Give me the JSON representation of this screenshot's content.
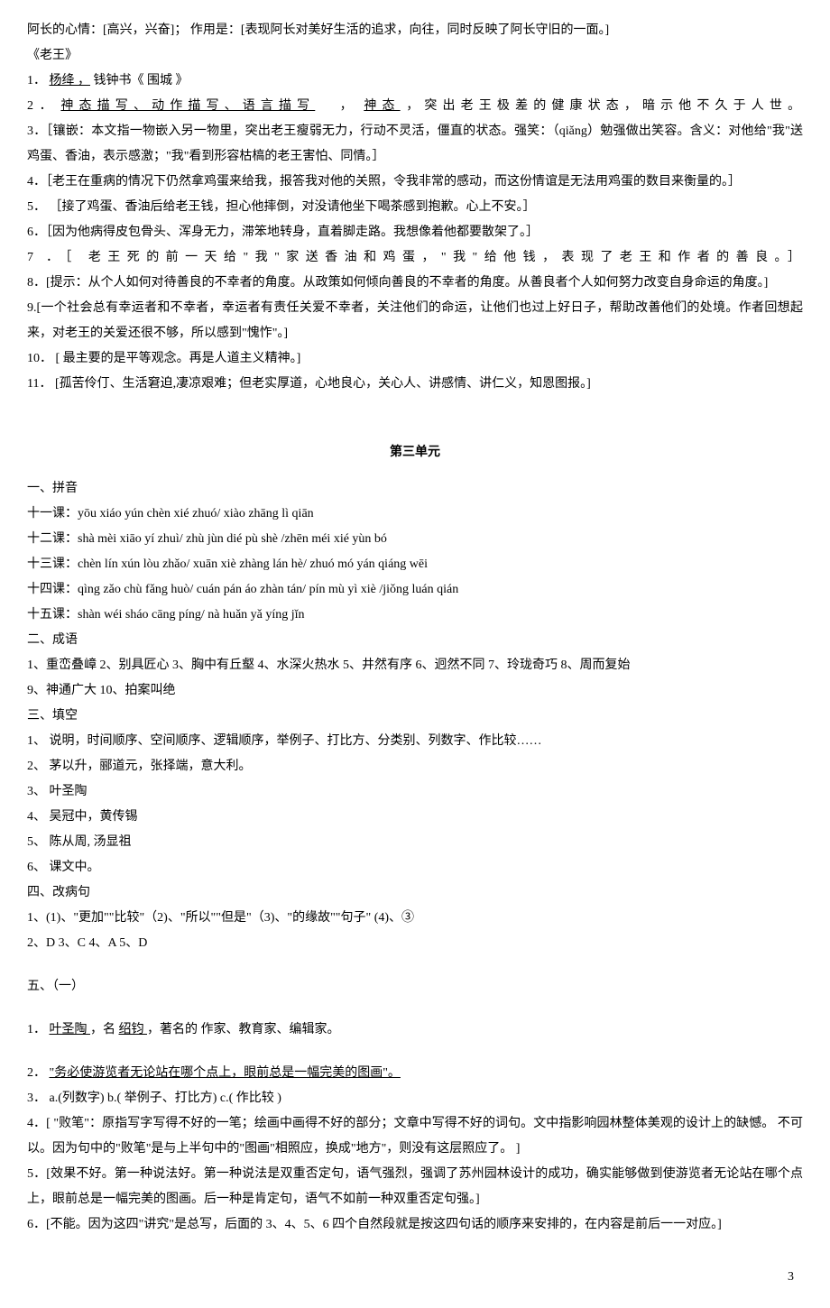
{
  "top": {
    "l1": "阿长的心情：[高兴，兴奋]；   作用是：[表现阿长对美好生活的追求，向往，同时反映了阿长守旧的一面。]",
    "l2": "《老王》",
    "l3_a": "1．",
    "l3_b": "杨绛 ，",
    "l3_c": "钱钟书《 围城 》",
    "l4_a": "2  ． ",
    "l4_b": "神态描写、动作描写、语言描写",
    "l4_c": "，",
    "l4_d": "神态",
    "l4_e": "，突出老王极差的健康状态，暗示他不久于人世。",
    "l5": "3．［镶嵌：本文指一物嵌入另一物里，突出老王瘦弱无力，行动不灵活，僵直的状态。强笑：（qiǎng）勉强做出笑容。含义：对他给\"我\"送鸡蛋、香油，表示感激；\"我\"看到形容枯槁的老王害怕、同情。］",
    "l6": "4．［老王在重病的情况下仍然拿鸡蛋来给我，报答我对他的关照，令我非常的感动，而这份情谊是无法用鸡蛋的数目来衡量的。］",
    "l7": "5．  ［接了鸡蛋、香油后给老王钱，担心他摔倒，对没请他坐下喝茶感到抱歉。心上不安。］",
    "l8": "6．［因为他病得皮包骨头、浑身无力，滞笨地转身，直着脚走路。我想像着他都要散架了。］",
    "l9": "7 ．［ 老王死的前一天给\"我\"家送香油和鸡蛋，\"我\"给他钱，表现了老王和作者的善良。］",
    "l10": "8．[提示：从个人如何对待善良的不幸者的角度。从政策如何倾向善良的不幸者的角度。从善良者个人如何努力改变自身命运的角度。]",
    "l11": "9.[一个社会总有幸运者和不幸者，幸运者有责任关爱不幸者，关注他们的命运，让他们也过上好日子，帮助改善他们的处境。作者回想起来，对老王的关爱还很不够，所以感到\"愧怍\"。]",
    "l12": "10． [ 最主要的是平等观念。再是人道主义精神。]",
    "l13": "11． [孤苦伶仃、生活窘迫,凄凉艰难；但老实厚道，心地良心，关心人、讲感情、讲仁义，知恩图报。]"
  },
  "unit3": {
    "title": "第三单元",
    "s1_title": "一、拼音",
    "s1_l11": "十一课：yōu xiáo yún chèn xié zhuó/ xiào zhāng lì qiān",
    "s1_l12": "十二课：shà mèi xiāo yí zhuì/ zhù jùn dié pù shè /zhēn méi xié yùn bó",
    "s1_l13": "十三课：chèn lín xún lòu zhǎo/ xuān xiè zhàng lán hè/ zhuó mó yán qiáng wēi",
    "s1_l14": "十四课：qìng zǎo chù fǎng huò/ cuán pán áo zhàn tán/ pín mù yì xiè /jiǒng luán qián",
    "s1_l15": "十五课：shàn wéi sháo cāng píng/ nà huǎn yǎ yíng jǐn",
    "s2_title": "二、成语",
    "s2_l1": "1、重峦叠嶂 2、别具匠心 3、胸中有丘壑 4、水深火热水 5、井然有序 6、迥然不同 7、玲珑奇巧 8、周而复始",
    "s2_l2": "9、神通广大 10、拍案叫绝",
    "s3_title": "三、填空",
    "s3_l1": "1、 说明，时间顺序、空间顺序、逻辑顺序，举例子、打比方、分类别、列数字、作比较……",
    "s3_l2": "2、 茅以升，郦道元，张择端，意大利。",
    "s3_l3": "3、 叶圣陶",
    "s3_l4": "4、 吴冠中，黄传锡",
    "s3_l5": "5、 陈从周, 汤显祖",
    "s3_l6": "6、 课文中。",
    "s4_title": "四、改病句",
    "s4_l1": "1、(1)、\"更加\"\"比较\"（2)、\"所以\"\"但是\"（3)、\"的缘故\"\"句子\" (4)、③",
    "s4_l2": "2、D    3、C    4、A    5、D",
    "s5_title": "五、（一）",
    "s5_l1a": "1．",
    "s5_l1b": "叶圣陶    ",
    "s5_l1c": "，名",
    "s5_l1d": " 绍钧 ",
    "s5_l1e": "，著名的  作家、教育家、编辑家。",
    "s5_l2a": "2．",
    "s5_l2b": "\"务必使游览者无论站在哪个点上，眼前总是一幅完美的图画\"。",
    "s5_l3": "3． a.(列数字)  b.(  举例子、打比方)  c.( 作比较 )",
    "s5_l4": "4．[ \"败笔\"：原指写字写得不好的一笔；绘画中画得不好的部分；文章中写得不好的词句。文中指影响园林整体美观的设计上的缺憾。   不可以。因为句中的\"败笔\"是与上半句中的\"图画\"相照应，换成\"地方\"，则没有这层照应了。 ]",
    "s5_l5": "5．[效果不好。第一种说法好。第一种说法是双重否定句，语气强烈，强调了苏州园林设计的成功，确实能够做到使游览者无论站在哪个点上，眼前总是一幅完美的图画。后一种是肯定句，语气不如前一种双重否定句强。]",
    "s5_l6": "6．[不能。因为这四\"讲究\"是总写，后面的 3、4、5、6 四个自然段就是按这四句话的顺序来安排的，在内容是前后一一对应。]"
  },
  "page_number": "3"
}
